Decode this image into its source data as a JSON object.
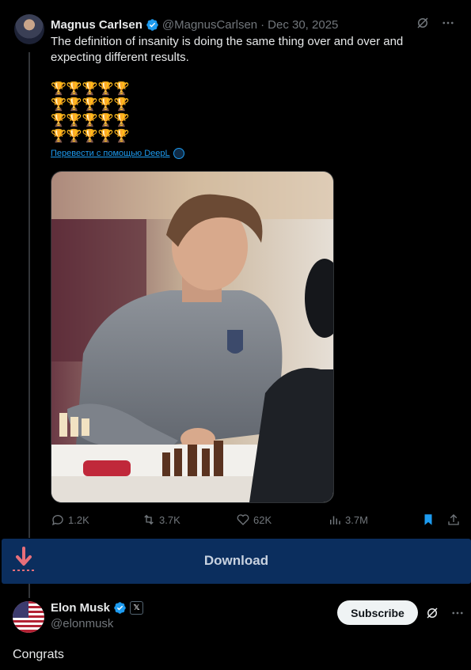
{
  "tweet": {
    "author_name": "Magnus Carlsen",
    "handle": "@MagnusCarlsen",
    "separator": "·",
    "date": "Dec 30, 2025",
    "text": "The definition of insanity is doing the same thing over and over and expecting different results.",
    "trophy_rows": [
      "🏆🏆🏆🏆🏆",
      "🏆🏆🏆🏆🏆",
      "🏆🏆🏆🏆🏆",
      "🏆🏆🏆🏆🏆"
    ],
    "translate_link": "Перевести с помощью DeepL",
    "icons": {
      "grok": "grok-icon",
      "more": "more-icon",
      "verified": "verified-badge-icon"
    },
    "stats": {
      "replies": "1.2K",
      "reposts": "3.7K",
      "likes": "62K",
      "views": "3.7M"
    }
  },
  "download": {
    "label": "Download",
    "icon": "download-arrow-icon"
  },
  "reply": {
    "author_name": "Elon Musk",
    "handle": "@elonmusk",
    "affiliate_badge": "𝕏",
    "subscribe_label": "Subscribe",
    "text": "Congrats"
  },
  "colors": {
    "background": "#000000",
    "text": "#e7e9ea",
    "muted": "#71767b",
    "accent": "#1d9bf0",
    "download_bar": "#0b2e5e"
  }
}
